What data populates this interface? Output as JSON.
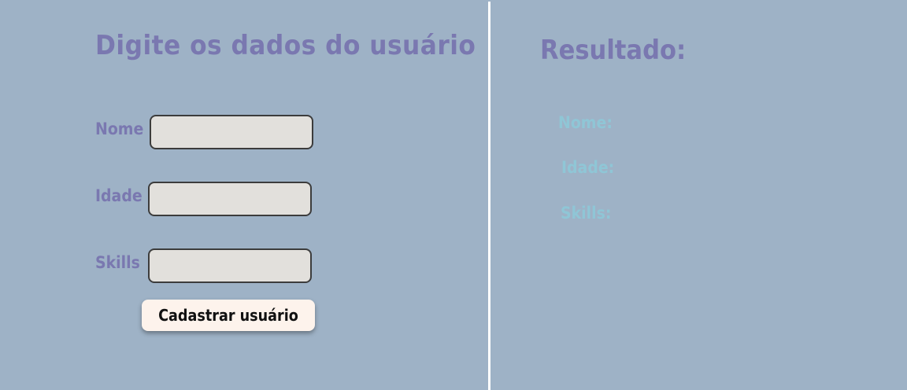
{
  "form": {
    "title": "Digite os dados do usuário",
    "fields": [
      {
        "label": "Nome",
        "value": "",
        "placeholder": ""
      },
      {
        "label": "Idade",
        "value": "",
        "placeholder": ""
      },
      {
        "label": "Skills",
        "value": "",
        "placeholder": ""
      }
    ],
    "submit_label": "Cadastrar usuário"
  },
  "result": {
    "title": "Resultado:",
    "labels": [
      "Nome:",
      "Idade:",
      "Skills:"
    ]
  },
  "colors": {
    "background": "#9eb2c6",
    "heading": "#7a78b0",
    "result_label": "#8fc6d6",
    "input_bg": "#e2e0dc",
    "button_bg": "#fdf3ec",
    "divider": "#ffffff"
  }
}
